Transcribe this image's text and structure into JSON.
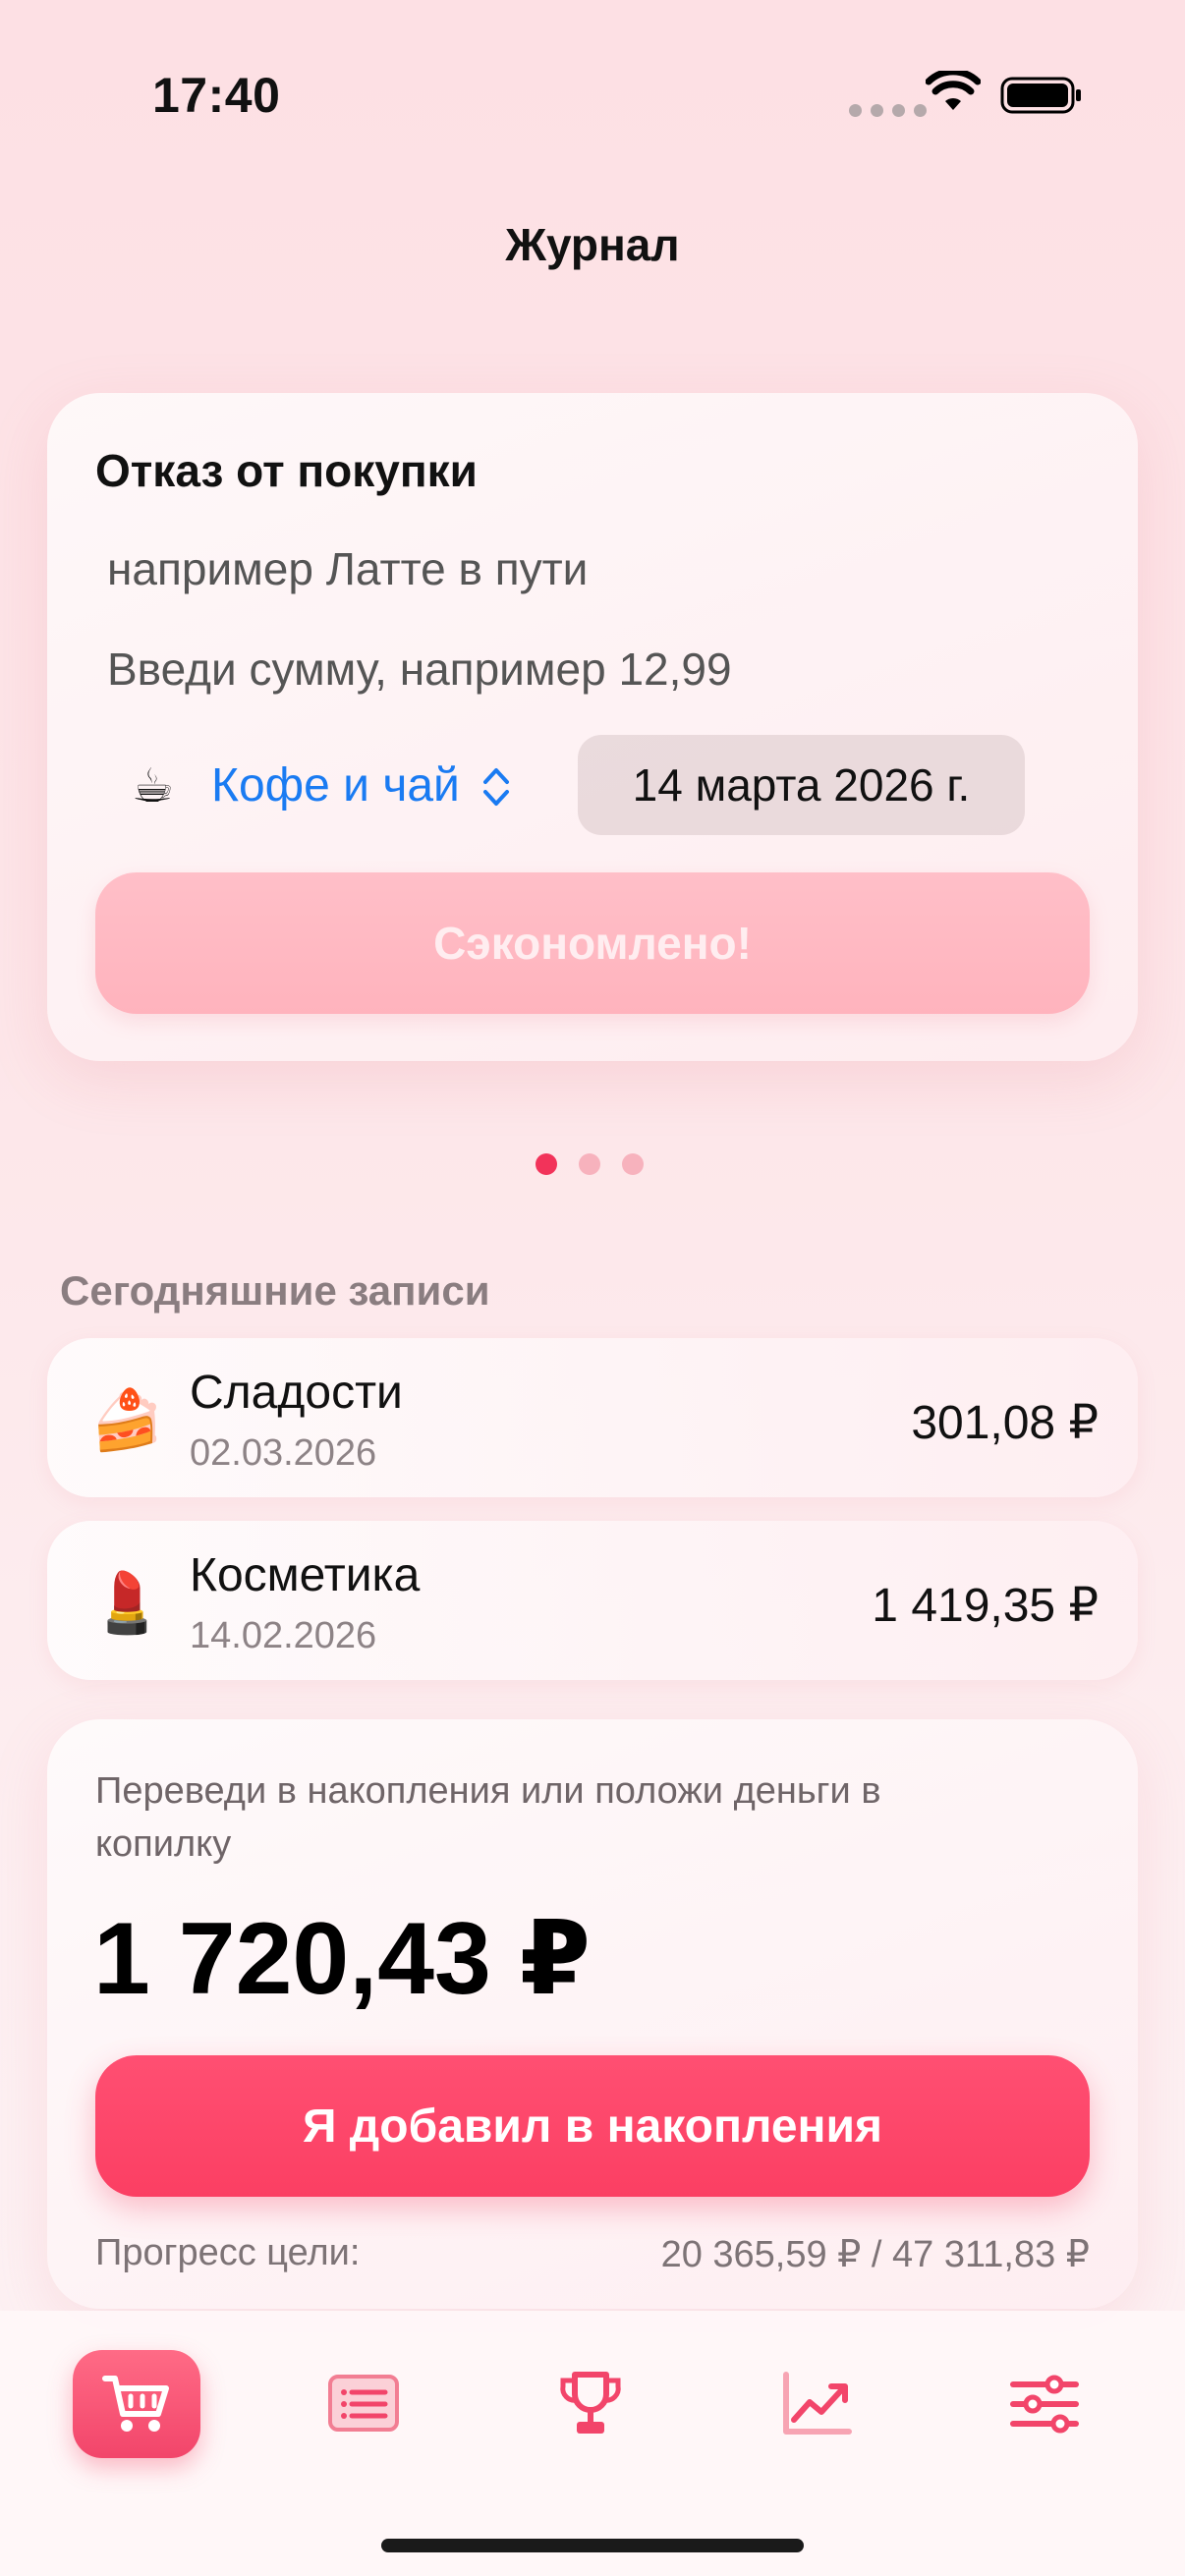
{
  "status_bar": {
    "time": "17:40"
  },
  "nav": {
    "title": "Журнал"
  },
  "entry_card": {
    "title": "Отказ от покупки",
    "name_placeholder": "например Латте в пути",
    "amount_placeholder": "Введи сумму, например 12,99",
    "category": {
      "emoji": "☕",
      "label": "Кофе и чай"
    },
    "date": "14 марта 2026 г.",
    "submit_label": "Сэкономлено!"
  },
  "pager": {
    "count": 3,
    "active_index": 0
  },
  "today_section": {
    "title": "Сегодняшние записи",
    "items": [
      {
        "emoji": "🍰",
        "name": "Сладости",
        "date": "02.03.2026",
        "amount": "301,08 ₽"
      },
      {
        "emoji": "💄",
        "name": "Косметика",
        "date": "14.02.2026",
        "amount": "1 419,35 ₽"
      }
    ]
  },
  "savings_card": {
    "hint": "Переведи в накопления или положи деньги в копилку",
    "amount": "1 720,43 ₽",
    "button_label": "Я добавил в накопления",
    "progress_label": "Прогресс цели:",
    "progress_value": "20 365,59 ₽ / 47 311,83 ₽"
  },
  "tab_bar": {
    "tabs": [
      {
        "icon": "cart-icon",
        "active": true
      },
      {
        "icon": "list-icon",
        "active": false
      },
      {
        "icon": "trophy-icon",
        "active": false
      },
      {
        "icon": "chart-icon",
        "active": false
      },
      {
        "icon": "sliders-icon",
        "active": false
      }
    ]
  },
  "colors": {
    "accent": "#f2456a",
    "link": "#1a7bf2",
    "background": "#fde6e9"
  }
}
